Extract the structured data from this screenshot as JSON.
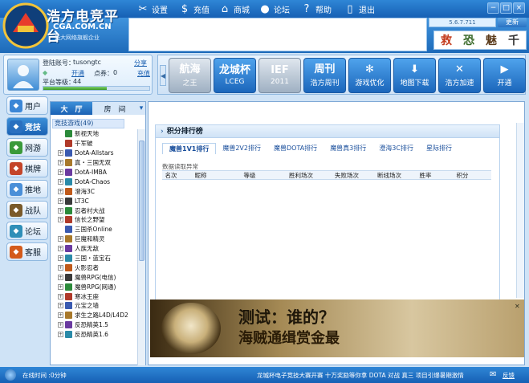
{
  "app": {
    "version": "5.6.7.711",
    "update_label": "更新"
  },
  "menu": {
    "settings": "设置",
    "recharge": "充值",
    "mall": "商城",
    "forum": "论坛",
    "help": "帮助",
    "exit": "退出"
  },
  "logo": {
    "title": "浩方电竞平台",
    "domain": "CGA.COM.CN",
    "slogan": "盛大网络旗舰企业"
  },
  "quick_icons": [
    "救",
    "恐",
    "魅",
    "千"
  ],
  "user": {
    "account_label": "登陆账号：",
    "account": "tusongtc",
    "share": "分享",
    "activate": "开通",
    "points_label": "点券：",
    "points": "0",
    "recharge": "充值",
    "level_label": "平台等级：",
    "level": "44",
    "level_progress": 0.6
  },
  "tiles": [
    {
      "title": "航海",
      "sub": "之王"
    },
    {
      "title": "龙城杯",
      "sub": "LCEG"
    },
    {
      "title": "IEF",
      "sub": "2011"
    },
    {
      "title": "周刊",
      "sub": "浩方周刊"
    },
    {
      "title": "✻",
      "sub": "游戏优化"
    },
    {
      "title": "⬇",
      "sub": "地图下载"
    },
    {
      "title": "✕",
      "sub": "浩方加速"
    },
    {
      "title": "▶",
      "sub": "开通"
    }
  ],
  "nav": [
    {
      "label": "用户",
      "icon": "user-icon"
    },
    {
      "label": "竞技",
      "icon": "compete-icon"
    },
    {
      "label": "网游",
      "icon": "online-game-icon"
    },
    {
      "label": "棋牌",
      "icon": "chess-icon"
    },
    {
      "label": "推地",
      "icon": "push-icon"
    },
    {
      "label": "战队",
      "icon": "team-icon"
    },
    {
      "label": "论坛",
      "icon": "forum-icon"
    },
    {
      "label": "客服",
      "icon": "service-icon"
    }
  ],
  "tree": {
    "tabs": [
      "大　厅",
      "房　间"
    ],
    "root": "竞技游戏(49)",
    "items": [
      {
        "label": "新视天地",
        "exp": false
      },
      {
        "label": "千军破",
        "exp": false
      },
      {
        "label": "DotA-Allstars",
        "exp": true
      },
      {
        "label": "真・三国无双",
        "exp": true
      },
      {
        "label": "DotA-IMBA",
        "exp": true
      },
      {
        "label": "DotA-Chaos",
        "exp": true
      },
      {
        "label": "澄海3C",
        "exp": true
      },
      {
        "label": "LT3C",
        "exp": true
      },
      {
        "label": "忍者村大战",
        "exp": true
      },
      {
        "label": "信长之野望",
        "exp": true
      },
      {
        "label": "三国杀Online",
        "exp": false
      },
      {
        "label": "巨魔和精灵",
        "exp": true
      },
      {
        "label": "人族无敌",
        "exp": true
      },
      {
        "label": "三国・蓝宝石",
        "exp": true
      },
      {
        "label": "火影忍者",
        "exp": true
      },
      {
        "label": "魔兽RPG(电信)",
        "exp": true
      },
      {
        "label": "魔兽RPG(网通)",
        "exp": true
      },
      {
        "label": "寒冰王座",
        "exp": true
      },
      {
        "label": "元宝之墙",
        "exp": true
      },
      {
        "label": "求生之路L4D/L4D2",
        "exp": true
      },
      {
        "label": "反恐精英1.5",
        "exp": true
      },
      {
        "label": "反恐精英1.6",
        "exp": true
      }
    ]
  },
  "ranking": {
    "title": "积分排行榜",
    "tabs": [
      "魔兽1V1排行",
      "魔兽2V2排行",
      "魔兽DOTA排行",
      "魔兽真3排行",
      "澄海3C排行",
      "星际排行"
    ],
    "error": "数据读取异常",
    "columns": [
      "名次",
      "昵称",
      "等级",
      "胜利场次",
      "失败场次",
      "断线场次",
      "胜率",
      "积分"
    ]
  },
  "promo": {
    "line1": "测试：谁的？",
    "line2": "海贼通缉赏金最"
  },
  "status": {
    "online_time": "在线时间 :0分钟",
    "ticker": "龙城杯电子竞技大赛开赛 十万奖励等你拿 DOTA 对战 真三 项目引爆暑期激情",
    "feedback": "反馈"
  },
  "colors": {
    "primary": "#1d6ab9",
    "accent": "#2f86d6",
    "link": "#1a5fb0"
  }
}
